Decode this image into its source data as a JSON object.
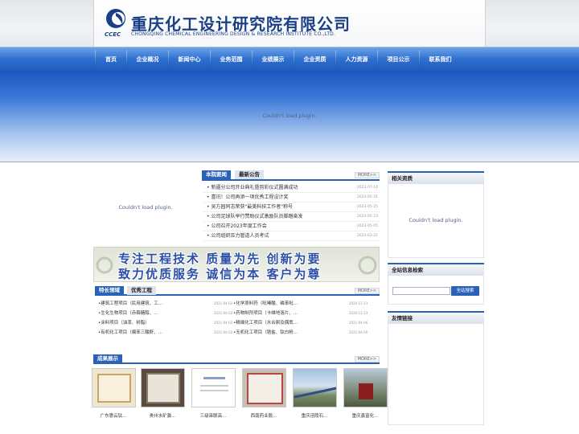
{
  "header": {
    "logo_abbr": "CCEC",
    "company_cn": "重庆化工设计研究院有限公司",
    "company_en": "CHONGQING CHEMICAL ENGINEERING DESIGN & RESEARCH INSTITUTE CO.,LTD.",
    "brand_color": "#1a3f86"
  },
  "nav": {
    "items": [
      "首页",
      "企业概况",
      "新闻中心",
      "业务范围",
      "业绩展示",
      "企业资质",
      "人力资源",
      "项目公示",
      "联系我们"
    ]
  },
  "banner": {
    "plugin_message": "Couldn't load plugin."
  },
  "left_plugin": {
    "plugin_message": "Couldn't load plugin."
  },
  "news": {
    "tabs": [
      "本院要闻",
      "最新公告"
    ],
    "more": "MORE>>",
    "items": [
      {
        "title": "新疆分公司开业典礼暨剪彩仪式圆满成功",
        "date": "2023-07-14"
      },
      {
        "title": "喜讯！公司再添一项优秀工程设计奖",
        "date": "2023-05-31"
      },
      {
        "title": "吴方园同志荣获\"最美科技工作者\"称号",
        "date": "2023-05-25"
      },
      {
        "title": "公司足球队举行赞助仪式激励队员脚踏奋发",
        "date": "2023-05-23"
      },
      {
        "title": "公司召开2023年度工作会",
        "date": "2023-05-05"
      },
      {
        "title": "公司组织压力管道人员考试",
        "date": "2023-03-22"
      }
    ]
  },
  "slogan": {
    "line1": "专注工程技术  质量为先  创新为要",
    "line2": "致力优质服务  诚信为本  客户为尊"
  },
  "projects": {
    "tabs": [
      "特长领域",
      "优秀工程"
    ],
    "more": "MORE>>",
    "items": [
      {
        "left": "建筑工程项目（民用建筑、工...",
        "left_date": "2021-04-02",
        "right": "化学原料药（吡嗪酸、磷苯吡...",
        "right_date": "2020-11-23"
      },
      {
        "left": "生化生物项目（赤藓糖醇、...",
        "left_date": "2021-04-02",
        "right": "药物制剂项目（卡维地洛片、...",
        "right_date": "2020-11-23"
      },
      {
        "left": "涂料项目（油漆、树脂）",
        "left_date": "2021-04-02",
        "right": "精细化工项目（水合肼及偶氮...",
        "right_date": "2021-04-06"
      },
      {
        "left": "有机化工项目（偏苯三酸酐、...",
        "left_date": "2021-04-02",
        "right": "无机化工项目（锆盐、钛白粉...",
        "right_date": "2021-04-06"
      }
    ]
  },
  "gallery": {
    "title": "成果展示",
    "more": "MORE>>",
    "items": [
      {
        "caption": "广东惠云钛...",
        "kind": "certificate"
      },
      {
        "caption": "贵州水矿瀛...",
        "kind": "certificate-dark"
      },
      {
        "caption": "三级串联高...",
        "kind": "certificate-white"
      },
      {
        "caption": "西南药业股...",
        "kind": "certificate-red"
      },
      {
        "caption": "重庆涪陵石...",
        "kind": "photo-bridge"
      },
      {
        "caption": "重庆鑫富化...",
        "kind": "photo-plant"
      }
    ]
  },
  "sidebar": {
    "related_title": "相关资质",
    "related_plugin_message": "Couldn't load plugin.",
    "search_title": "全站信息检索",
    "search_value": "",
    "search_button": "全站搜索",
    "links_title": "友情链接"
  },
  "colors": {
    "accent": "#2a62b8",
    "nav": "#2f6fd0"
  }
}
